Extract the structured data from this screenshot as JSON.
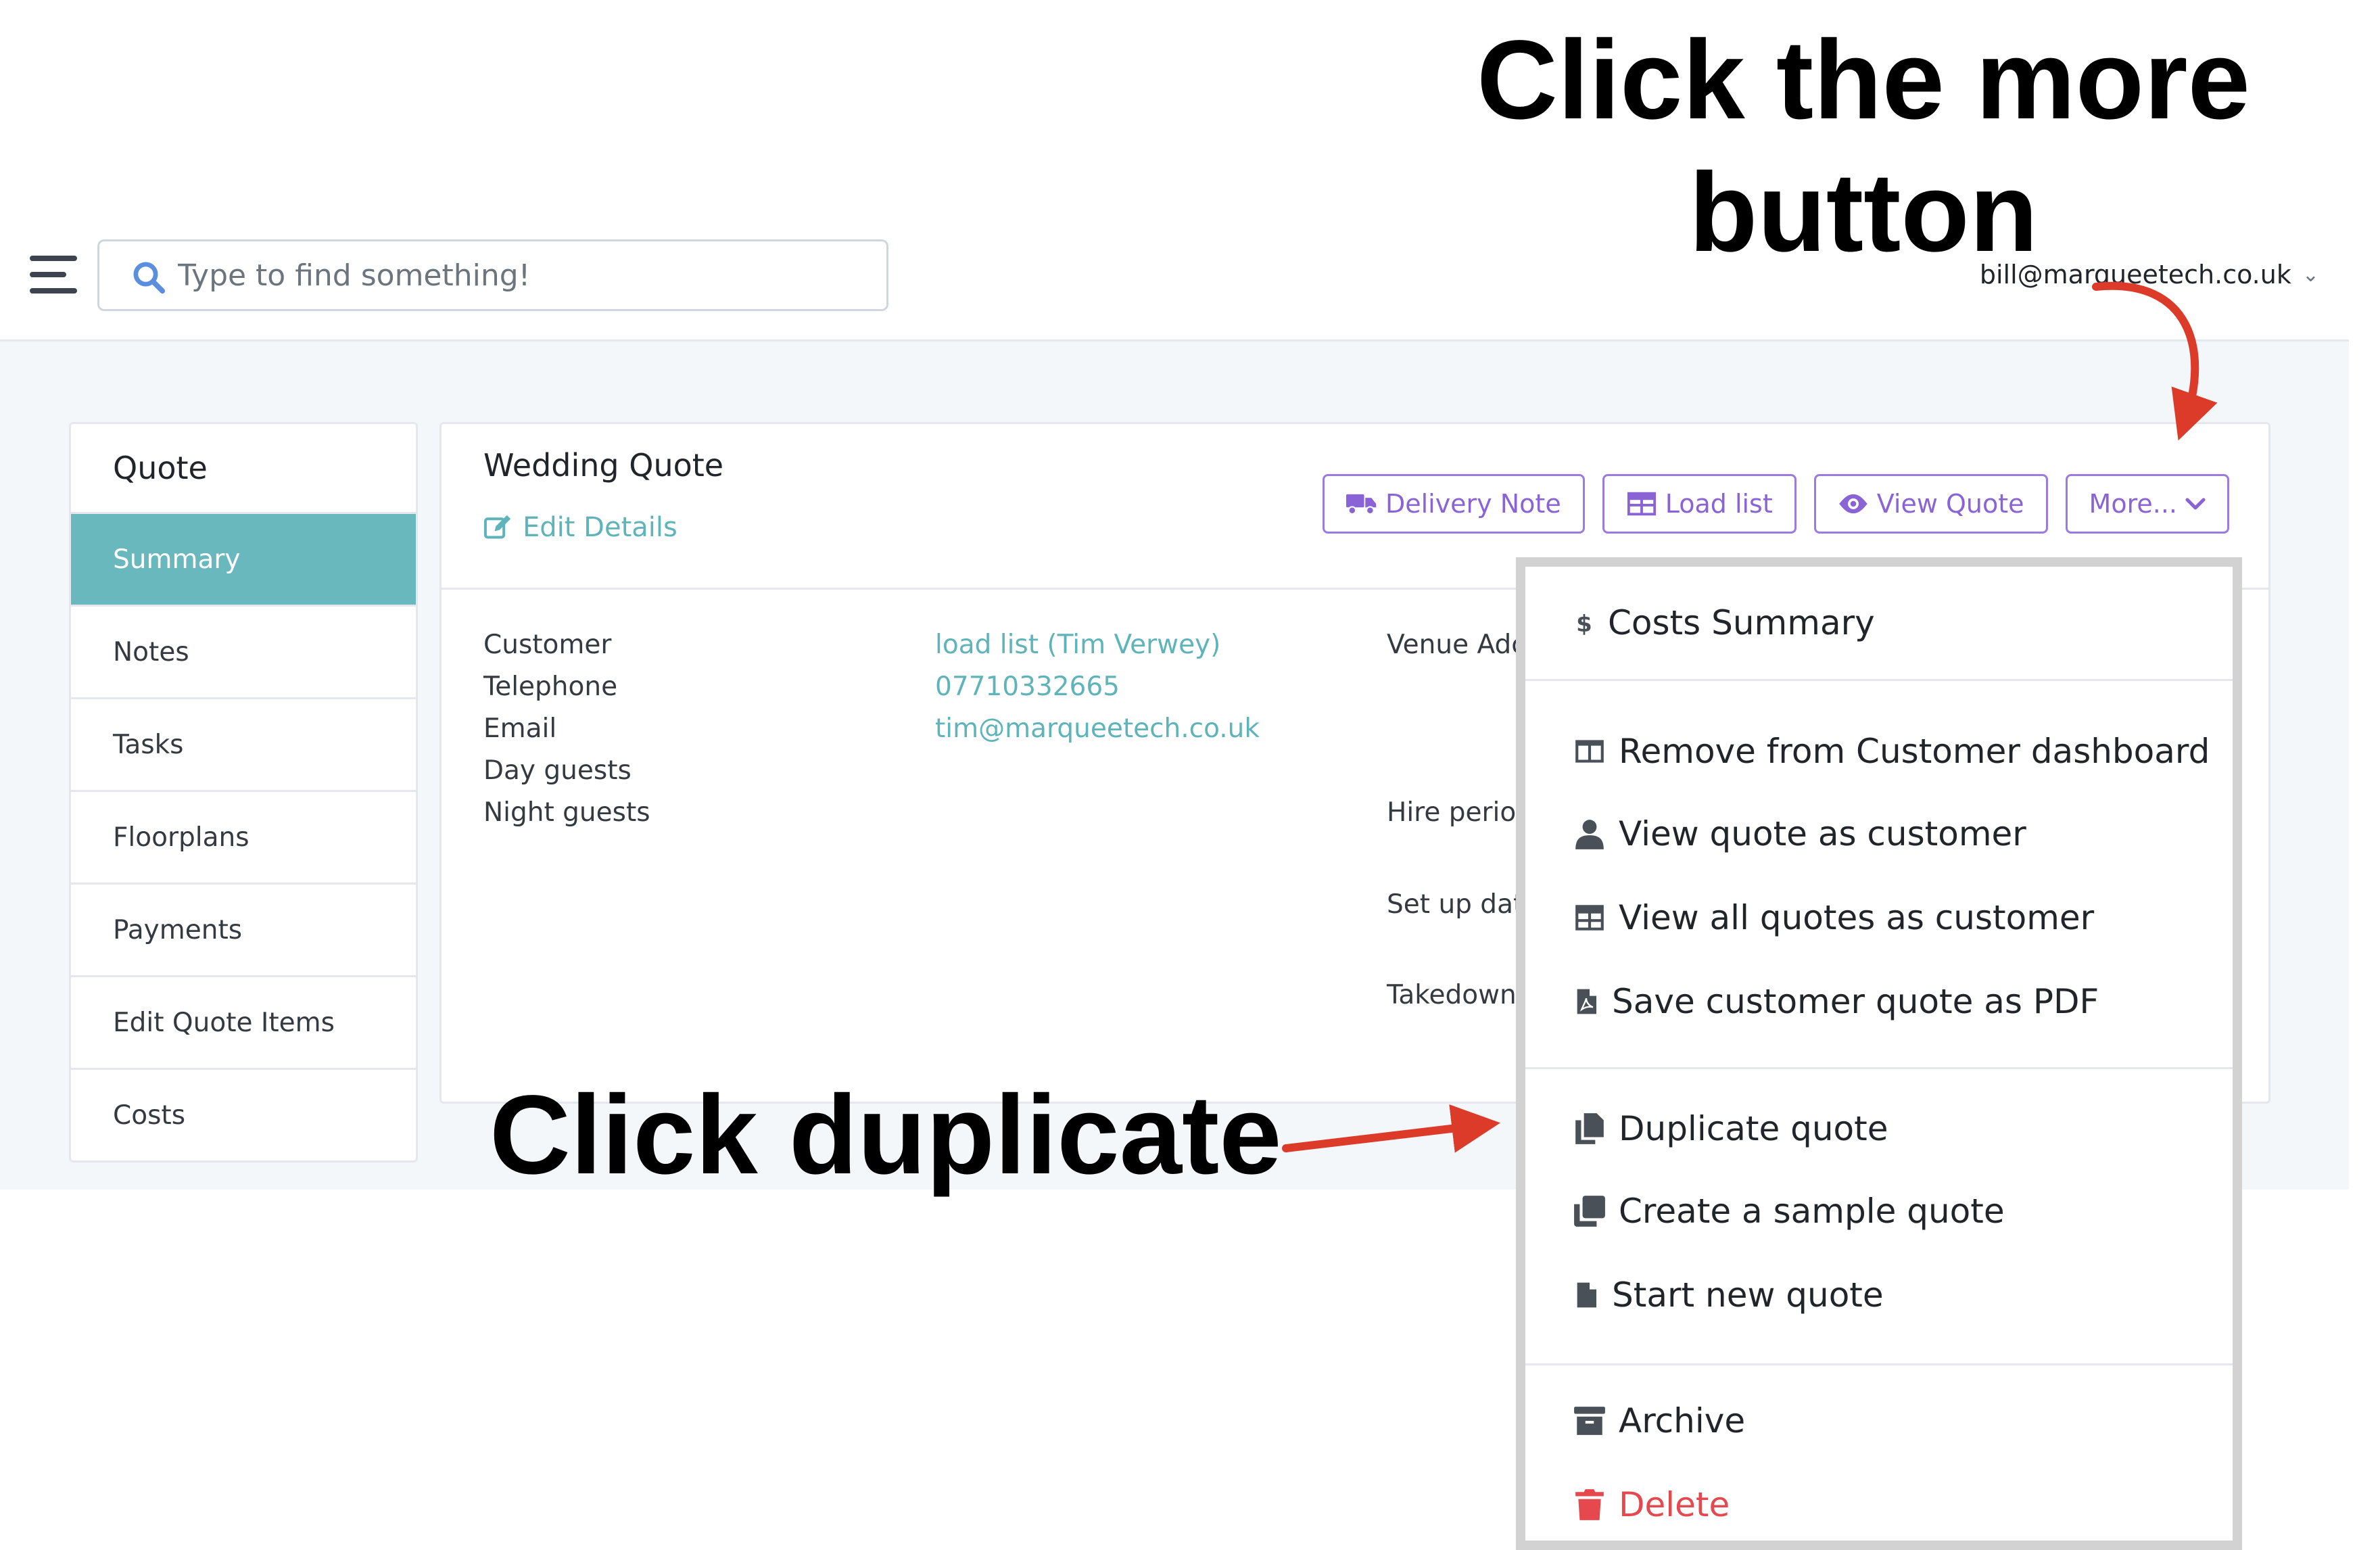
{
  "annotations": {
    "top_line1": "Click the more",
    "top_line2": "button",
    "bottom": "Click duplicate"
  },
  "header": {
    "search_placeholder": "Type to find something!",
    "user_email": "bill@marqueetech.co.uk"
  },
  "sidebar": {
    "title": "Quote",
    "items": [
      {
        "label": "Summary",
        "active": true
      },
      {
        "label": "Notes"
      },
      {
        "label": "Tasks"
      },
      {
        "label": "Floorplans"
      },
      {
        "label": "Payments"
      },
      {
        "label": "Edit Quote Items"
      },
      {
        "label": "Costs"
      }
    ]
  },
  "quote": {
    "title": "Wedding Quote",
    "edit_link": "Edit Details",
    "buttons": {
      "delivery_note": "Delivery Note",
      "load_list": "Load list",
      "view_quote": "View Quote",
      "more": "More..."
    },
    "fields": [
      {
        "label": "Customer",
        "value": "load list (Tim Verwey)"
      },
      {
        "label": "Telephone",
        "value": "07710332665"
      },
      {
        "label": "Email",
        "value": "tim@marqueetech.co.uk"
      },
      {
        "label": "Day guests",
        "value": ""
      },
      {
        "label": "Night guests",
        "value": ""
      }
    ],
    "right_labels": [
      "Venue Adc",
      "Hire perioc",
      "Set up dat",
      "Takedown"
    ]
  },
  "menu": {
    "items": [
      {
        "label": "Costs Summary",
        "icon": "dollar-icon"
      },
      {
        "label": "Remove from Customer dashboard",
        "icon": "columns-icon"
      },
      {
        "label": "View quote as customer",
        "icon": "user-icon"
      },
      {
        "label": "View all quotes as customer",
        "icon": "table-icon"
      },
      {
        "label": "Save customer quote as PDF",
        "icon": "pdf-icon"
      },
      {
        "label": "Duplicate quote",
        "icon": "copy-icon"
      },
      {
        "label": "Create a sample quote",
        "icon": "clone-icon"
      },
      {
        "label": "Start new quote",
        "icon": "file-icon"
      },
      {
        "label": "Archive",
        "icon": "archive-icon"
      },
      {
        "label": "Delete",
        "icon": "trash-icon",
        "color": "#e5484d"
      }
    ]
  },
  "colors": {
    "accent_teal": "#69b8bd",
    "link": "#5fb4ba",
    "button_purple": "#8a63d6",
    "arrow_red": "#dd3b2a",
    "danger": "#e5484d"
  }
}
